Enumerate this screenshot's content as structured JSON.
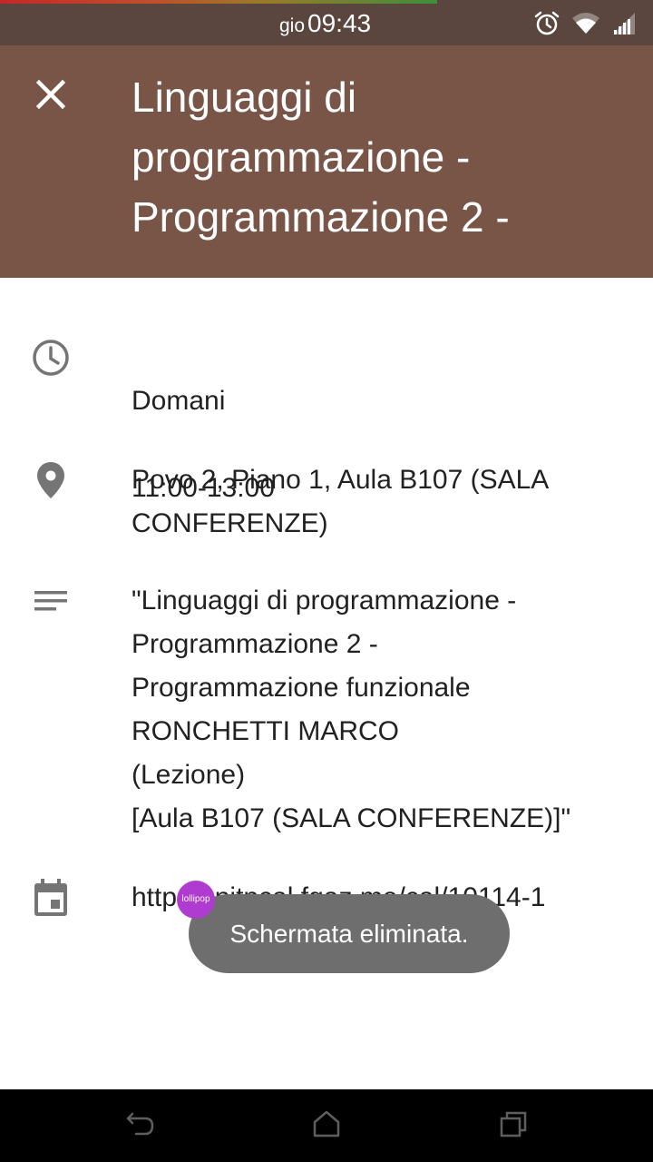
{
  "status_bar": {
    "day": "gio",
    "time": "09:43",
    "icons": [
      "alarm-icon",
      "wifi-icon",
      "signal-icon"
    ]
  },
  "app_bar": {
    "close_icon": "close-icon",
    "title": "Linguaggi di programmazione - Programmazione 2 -",
    "background_color": "#795548"
  },
  "details": {
    "when": {
      "icon": "clock-icon",
      "day": "Domani",
      "time_range": "11:00-13:00"
    },
    "where": {
      "icon": "location-pin-icon",
      "text": "Povo 2, Piano 1, Aula B107 (SALA CONFERENZE)"
    },
    "description": {
      "icon": "notes-icon",
      "text": "\"Linguaggi di programmazione -\nProgrammazione 2 -\nProgrammazione funzionale\nRONCHETTI MARCO\n(Lezione)\n[Aula B107 (SALA CONFERENZE)]\""
    },
    "calendar": {
      "icon": "calendar-icon",
      "text": "http://unitncal.fgaz.me/cal/10114-1"
    }
  },
  "toast": {
    "message": "Schermata eliminata.",
    "badge": "lollipop"
  },
  "nav_bar": {
    "icons": [
      "back-icon",
      "home-icon",
      "recent-apps-icon"
    ]
  }
}
